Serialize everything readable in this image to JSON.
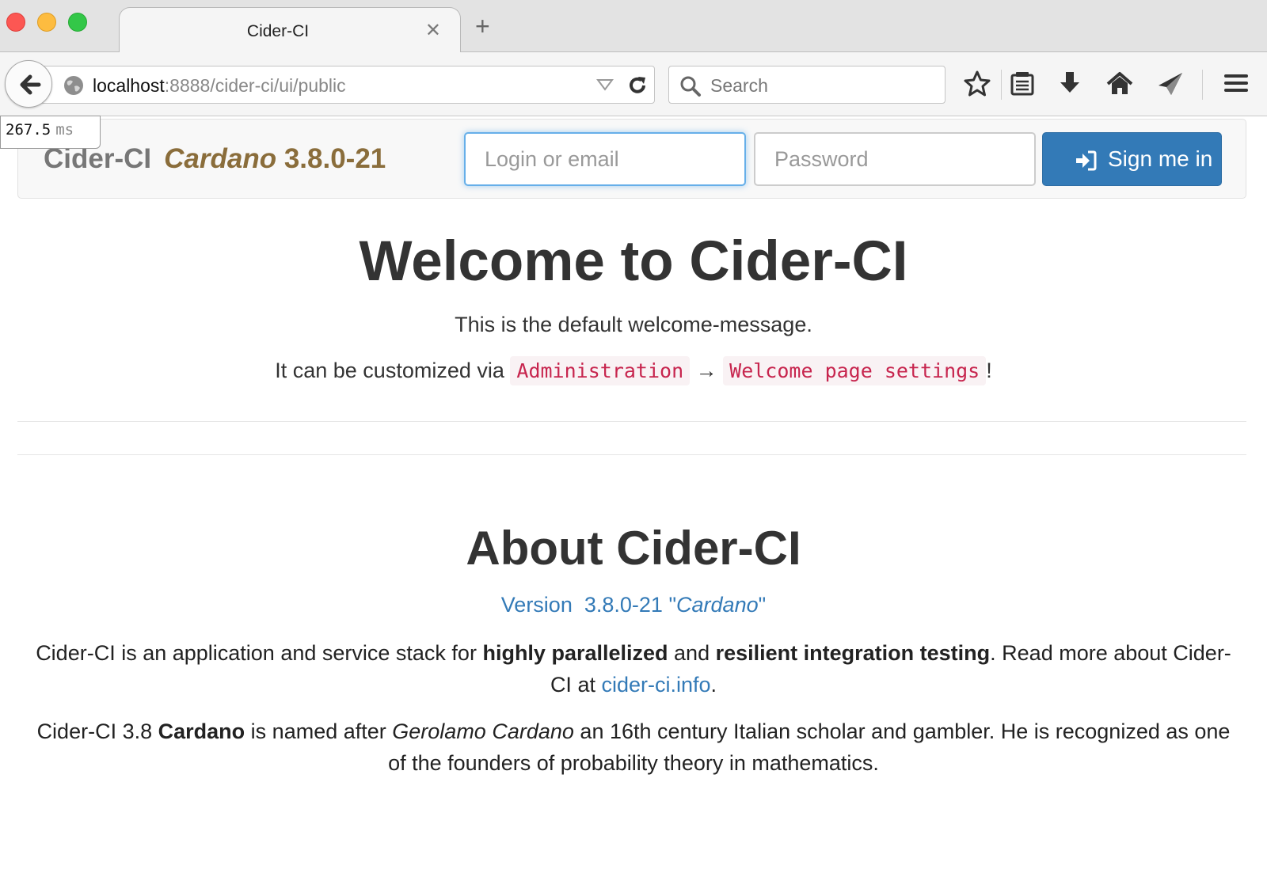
{
  "browser": {
    "tab_title": "Cider-CI",
    "tab_close": "✕",
    "new_tab": "+",
    "url_host": "localhost",
    "url_path": ":8888/cider-ci/ui/public",
    "search_placeholder": "Search",
    "toolbar_icons": [
      "back-arrow-icon",
      "globe-icon",
      "dropdown-icon",
      "reload-icon",
      "search-icon",
      "star-icon",
      "reading-list-icon",
      "download-icon",
      "home-icon",
      "send-icon",
      "hamburger-menu-icon"
    ]
  },
  "timing": {
    "value": "267.5",
    "unit": "ms"
  },
  "navbar": {
    "brand": "Cider-CI",
    "release_name": "Cardano",
    "release_version": "3.8.0-21",
    "login_placeholder": "Login or email",
    "password_placeholder": "Password",
    "signin_label": "Sign me in"
  },
  "welcome": {
    "title": "Welcome to Cider-CI",
    "message": "This is the default welcome-message.",
    "customize_prefix": "It can be customized via",
    "admin_code": "Administration",
    "arrow": "→",
    "settings_code": "Welcome page settings",
    "suffix": "!"
  },
  "about": {
    "title": "About Cider-CI",
    "version_label": "Version",
    "version_number": "3.8.0-21",
    "version_name": "Cardano",
    "p1_a": "Cider-CI is an application and service stack for",
    "p1_b": "highly parallelized",
    "p1_c": "and",
    "p1_d": "resilient integration testing",
    "p1_e": ". Read more about Cider-CI at",
    "p1_link": "cider-ci.info",
    "p1_f": ".",
    "p2_a": "Cider-CI 3.8",
    "p2_b": "Cardano",
    "p2_c": "is named after",
    "p2_d": "Gerolamo Cardano",
    "p2_e": "an 16th century Italian scholar and gambler. He is recognized as one of the founders of probability theory in mathematics."
  },
  "colors": {
    "primary": "#337ab7",
    "release": "#8a6d3b",
    "code": "#c7254e"
  }
}
